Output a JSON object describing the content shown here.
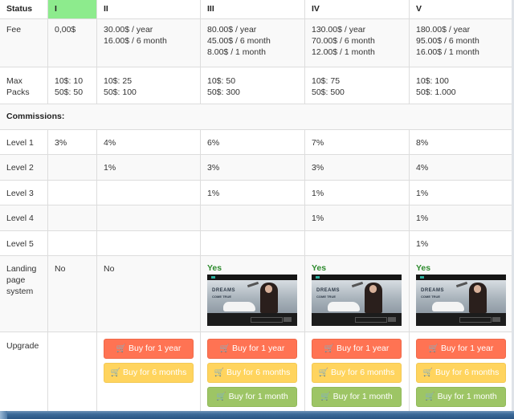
{
  "table": {
    "header": {
      "label": "Status",
      "columns": [
        "I",
        "II",
        "III",
        "IV",
        "V"
      ],
      "active_column": "I",
      "active_color": "#8deb8d"
    },
    "fee": {
      "label": "Fee",
      "values": [
        [
          "0,00$"
        ],
        [
          "30.00$ / year",
          "16.00$ / 6 month"
        ],
        [
          "80.00$ / year",
          "45.00$ / 6 month",
          "8.00$ / 1 month"
        ],
        [
          "130.00$ / year",
          "70.00$ / 6 month",
          "12.00$ / 1 month"
        ],
        [
          "180.00$ / year",
          "95.00$ / 6 month",
          "16.00$ / 1 month"
        ]
      ]
    },
    "max_packs": {
      "label_line1": "Max",
      "label_line2": "Packs",
      "values": [
        [
          "10$: 10",
          "50$: 50"
        ],
        [
          "10$: 25",
          "50$: 100"
        ],
        [
          "10$: 50",
          "50$: 300"
        ],
        [
          "10$: 75",
          "50$: 500"
        ],
        [
          "10$: 100",
          "50$: 1.000"
        ]
      ]
    },
    "commissions_label": "Commissions:",
    "levels": [
      {
        "label": "Level 1",
        "values": [
          "3%",
          "4%",
          "6%",
          "7%",
          "8%"
        ]
      },
      {
        "label": "Level 2",
        "values": [
          "",
          "1%",
          "3%",
          "3%",
          "4%"
        ]
      },
      {
        "label": "Level 3",
        "values": [
          "",
          "",
          "1%",
          "1%",
          "1%"
        ]
      },
      {
        "label": "Level 4",
        "values": [
          "",
          "",
          "",
          "1%",
          "1%"
        ]
      },
      {
        "label": "Level 5",
        "values": [
          "",
          "",
          "",
          "",
          "1%"
        ]
      }
    ],
    "landing": {
      "label_line1": "Landing",
      "label_line2": "page",
      "label_line3": "system",
      "values": [
        "No",
        "No",
        "Yes",
        "Yes",
        "Yes"
      ],
      "preview": {
        "headline": "DREAMS",
        "subline": "COME TRUE"
      }
    },
    "upgrade": {
      "label": "Upgrade",
      "buttons": {
        "year": "Buy for 1 year",
        "six_months": "Buy for 6 months",
        "one_month": "Buy for 1 month"
      },
      "colors": {
        "year": "#ff7353",
        "six_months": "#ffd45e",
        "one_month": "#9dc565"
      }
    }
  },
  "icons": {
    "cart": "🛒"
  }
}
